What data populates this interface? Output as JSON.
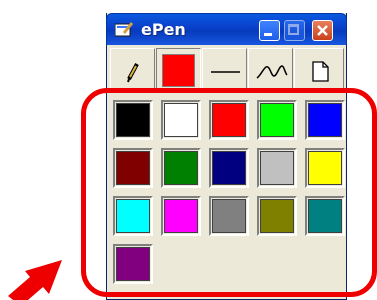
{
  "window": {
    "title": "ePen"
  },
  "toolbar": {
    "tools": [
      "pencil-icon",
      "current-color",
      "straight-line-icon",
      "freehand-line-icon",
      "new-page-icon"
    ],
    "current_color": "#ff0000"
  },
  "palette": {
    "colors": [
      "#000000",
      "#ffffff",
      "#ff0000",
      "#00ff00",
      "#0000ff",
      "#800000",
      "#008000",
      "#000080",
      "#c0c0c0",
      "#ffff00",
      "#00ffff",
      "#ff00ff",
      "#808080",
      "#808000",
      "#008080",
      "#800080"
    ]
  },
  "annotation": {
    "highlight_color": "#ee0000"
  }
}
